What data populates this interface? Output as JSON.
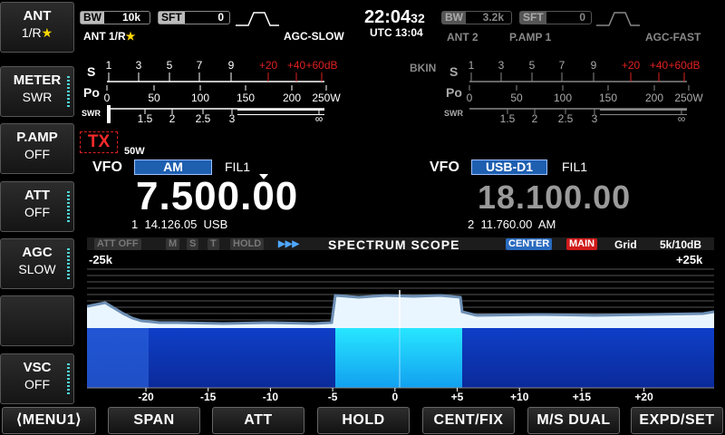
{
  "side_buttons": [
    {
      "title": "ANT",
      "value": "1/R",
      "star": "★"
    },
    {
      "title": "METER",
      "value": "SWR"
    },
    {
      "title": "P.AMP",
      "value": "OFF"
    },
    {
      "title": "ATT",
      "value": "OFF"
    },
    {
      "title": "AGC",
      "value": "SLOW"
    },
    {
      "title": "",
      "value": ""
    },
    {
      "title": "VSC",
      "value": "OFF"
    }
  ],
  "main": {
    "bw_label": "BW",
    "bw_value": "10k",
    "sft_label": "SFT",
    "sft_value": "0",
    "ant": "ANT 1/R",
    "ant_star": "★",
    "agc": "AGC-SLOW",
    "tx": "TX",
    "power": "50W",
    "vfo_label": "VFO",
    "mode": "AM",
    "fil": "FIL1",
    "freq": "7.500.00",
    "memo_num": "1",
    "memo_freq": "14.126.05",
    "memo_mode": "USB"
  },
  "clock": {
    "time": "22:04",
    "sec": "32",
    "utc": "UTC 13:04"
  },
  "sub": {
    "bw_label": "BW",
    "bw_value": "3.2k",
    "sft_label": "SFT",
    "sft_value": "0",
    "ant": "ANT 2",
    "pamp": "P.AMP 1",
    "agc": "AGC-FAST",
    "bkin": "BKIN",
    "vfo_label": "VFO",
    "mode": "USB-D1",
    "fil": "FIL1",
    "freq": "18.100.00",
    "memo_num": "2",
    "memo_freq": "11.760.00",
    "memo_mode": "AM"
  },
  "meter": {
    "s_label": "S",
    "po_label": "Po",
    "swr_label": "SWR",
    "s_ticks": [
      "1",
      "3",
      "5",
      "7",
      "9"
    ],
    "s_over": [
      "+20",
      "+40",
      "+60dB"
    ],
    "po_ticks": [
      "0",
      "50",
      "100",
      "150",
      "200",
      "250W"
    ],
    "swr_ticks": [
      "1",
      "1.5",
      "2",
      "2.5",
      "3",
      "∞"
    ]
  },
  "scope": {
    "att": "ATT OFF",
    "m": "M",
    "s": "S",
    "t": "T",
    "hold": "HOLD",
    "arrows": "▶▶▶",
    "title": "SPECTRUM SCOPE",
    "center": "CENTER",
    "main": "MAIN",
    "grid": "Grid",
    "ref": "5k/10dB",
    "left_span": "-25k",
    "right_span": "+25k",
    "axis": [
      "-20",
      "-15",
      "-10",
      "-5",
      "0",
      "+5",
      "+10",
      "+15",
      "+20"
    ],
    "main_color": "#d11a1a",
    "center_color": "#2a6bbf"
  },
  "bottom_buttons": [
    "⟨MENU1⟩",
    "SPAN",
    "ATT",
    "HOLD",
    "CENT/FIX",
    "M/S DUAL",
    "EXPD/SET"
  ]
}
